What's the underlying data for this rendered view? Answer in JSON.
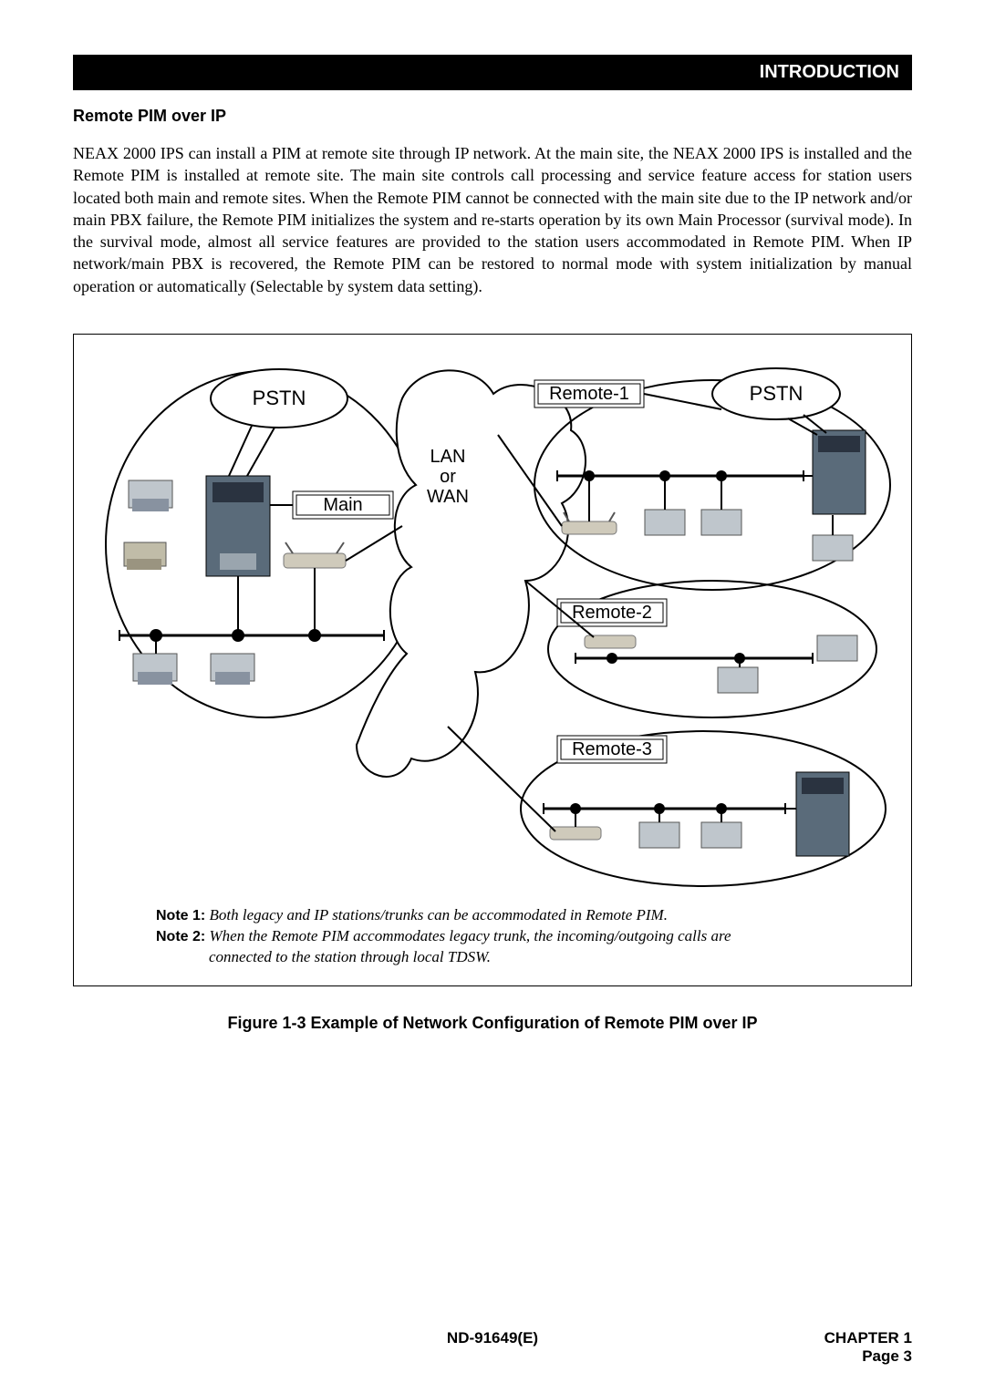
{
  "header": {
    "breadcrumb": "INTRODUCTION"
  },
  "section": {
    "title": "Remote PIM over IP",
    "body": "NEAX 2000 IPS can install a PIM at remote site through IP network. At the main site, the NEAX 2000 IPS is installed and the Remote PIM is installed at remote site. The main site controls call processing and service feature access for station users located both main and remote sites. When the Remote PIM cannot be connected with the main site due to the IP network and/or main PBX failure, the Remote PIM initializes the system and re-starts operation by its own Main Processor (survival mode). In the survival mode, almost all service features are provided to the station users accommodated in Remote PIM. When IP network/main PBX is recovered, the Remote PIM can be restored to normal mode with system initialization by manual operation or automatically (Selectable by system data setting)."
  },
  "diagram": {
    "pstn_left": "PSTN",
    "pstn_right": "PSTN",
    "main": "Main",
    "lan_wan_line1": "LAN",
    "lan_wan_line2": "or",
    "lan_wan_line3": "WAN",
    "remote1": "Remote-1",
    "remote2": "Remote-2",
    "remote3": "Remote-3"
  },
  "notes": {
    "n1_label": "Note 1:",
    "n1_body": "Both legacy and IP stations/trunks can be accommodated in Remote PIM.",
    "n2_label": "Note 2:",
    "n2_body_a": "When the Remote PIM accommodates legacy trunk, the incoming/outgoing calls are",
    "n2_body_b": "connected to the station through local TDSW."
  },
  "caption": "Figure 1-3  Example of Network Configuration of Remote PIM over IP",
  "footer": {
    "doc_id": "ND-91649(E)",
    "chapter": "CHAPTER 1",
    "page": "Page 3"
  }
}
